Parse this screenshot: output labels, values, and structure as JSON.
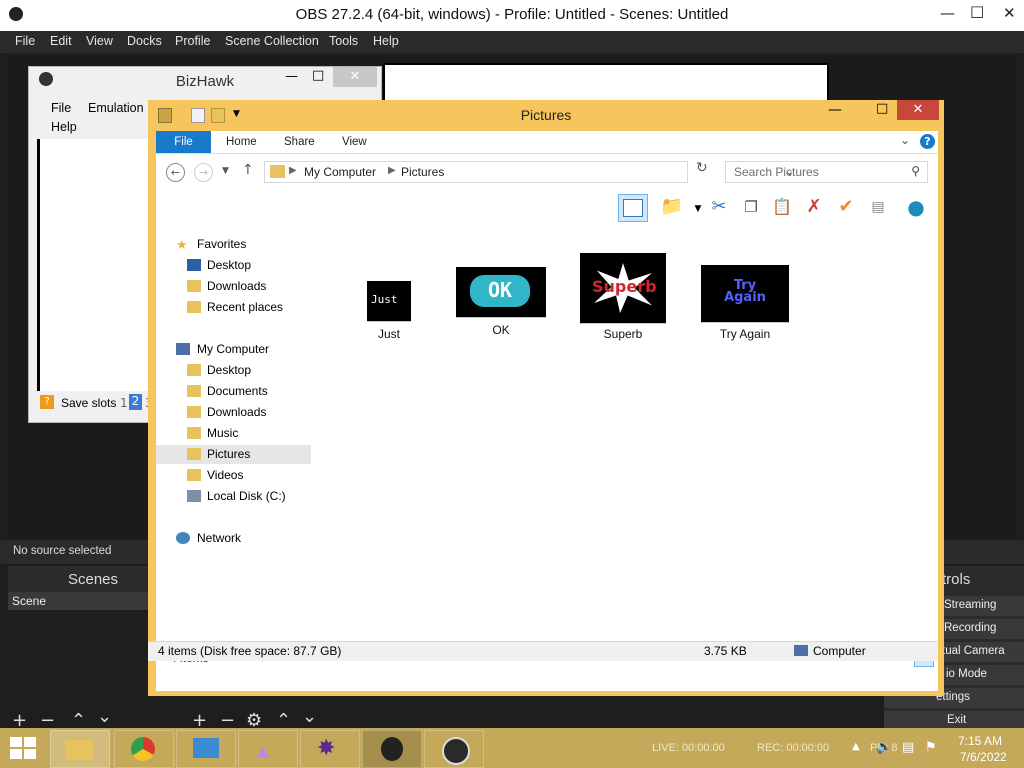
{
  "obs": {
    "title": "OBS 27.2.4 (64-bit, windows) - Profile: Untitled - Scenes: Untitled",
    "menu": [
      "File",
      "Edit",
      "View",
      "Docks",
      "Profile",
      "Scene Collection",
      "Tools",
      "Help"
    ],
    "no_source": "No source selected",
    "scenes_title": "Scenes",
    "scene_item": "Scene",
    "controls_title": "trols",
    "controls": [
      "Streaming",
      "Recording",
      "tual Camera",
      "io Mode",
      "ettings",
      "Exit"
    ],
    "status": {
      "live": "LIVE: 00:00:00",
      "rec": "REC: 00:00:00",
      "cpu": "PU: 8",
      "fps": "00 fps"
    }
  },
  "bizhawk": {
    "title": "BizHawk",
    "menu": {
      "file": "File",
      "emulation": "Emulation",
      "help": "Help"
    },
    "save_slots_label": "Save slots",
    "slots": [
      "1",
      "2",
      "3"
    ]
  },
  "explorer": {
    "title": "Pictures",
    "ribbon_tabs": {
      "file": "File",
      "home": "Home",
      "share": "Share",
      "view": "View"
    },
    "breadcrumb": [
      "My Computer",
      "Pictures"
    ],
    "search_placeholder": "Search Pictures",
    "nav": {
      "favorites": "Favorites",
      "fav_items": [
        "Desktop",
        "Downloads",
        "Recent places"
      ],
      "computer": "My Computer",
      "computer_items": [
        "Desktop",
        "Documents",
        "Downloads",
        "Music",
        "Pictures",
        "Videos",
        "Local Disk (C:)"
      ],
      "network": "Network",
      "selected": "Pictures"
    },
    "files": [
      {
        "name": "Just",
        "thumb_text": "Just"
      },
      {
        "name": "OK",
        "thumb_text": "OK"
      },
      {
        "name": "Superb",
        "thumb_text": "Superb"
      },
      {
        "name": "Try Again",
        "thumb_text": "Try Again"
      }
    ],
    "item_count": "4 items",
    "status_left": "4 items (Disk free space: 87.7 GB)",
    "status_size": "3.75 KB",
    "status_location": "Computer"
  },
  "taskbar": {
    "time": "7:15 AM",
    "date": "7/6/2022",
    "apps": [
      "start-button",
      "file-explorer-icon",
      "chrome-icon",
      "control-panel-icon",
      "app-triangle-icon",
      "app-star-icon",
      "bizhawk-icon",
      "obs-icon"
    ]
  },
  "colors": {
    "explorer_frame": "#f6c65c",
    "file_tab": "#1979ca",
    "close_button": "#c7473a",
    "obs_bg": "#2b2a2c"
  }
}
